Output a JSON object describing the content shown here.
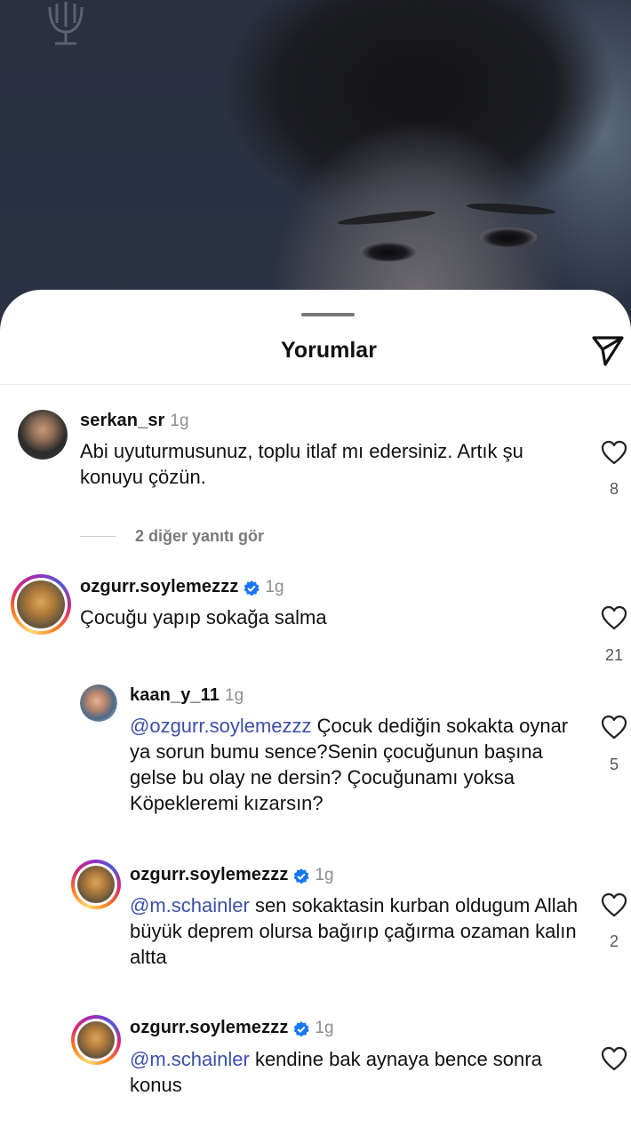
{
  "sheet": {
    "title": "Yorumlar"
  },
  "comments": [
    {
      "username": "serkan_sr",
      "time": "1g",
      "text": "Abi uyuturmusunuz, toplu itlaf mı edersiniz. Artık şu konuyu çözün.",
      "likes": "8"
    },
    {
      "username": "ozgurr.soylemezzz",
      "verified": true,
      "time": "1g",
      "text": "Çocuğu yapıp sokağa salma",
      "likes": "21"
    }
  ],
  "more_replies": "2 diğer yanıtı gör",
  "replies": [
    {
      "username": "kaan_y_11",
      "time": "1g",
      "mention": "@ozgurr.soylemezzz",
      "text": " Çocuk dediğin sokakta oynar ya sorun bumu sence?Senin çocuğunun başına gelse bu olay ne dersin? Çocuğunamı yoksa Köpeklеremi kızarsın?",
      "likes": "5"
    },
    {
      "username": "ozgurr.soylemezzz",
      "verified": true,
      "time": "1g",
      "mention": "@m.schainler",
      "text": " sen sokaktasin kurban oldugum Allah büyük deprem olursa bağırıp çağırma ozaman kalın altta",
      "likes": "2"
    },
    {
      "username": "ozgurr.soylemezzz",
      "verified": true,
      "time": "1g",
      "mention": "@m.schainler",
      "text": " kendine bak aynaya bence sonra konus",
      "likes": ""
    }
  ],
  "colors": {
    "mention": "#3b4fa8",
    "verified": "#1877f2"
  }
}
